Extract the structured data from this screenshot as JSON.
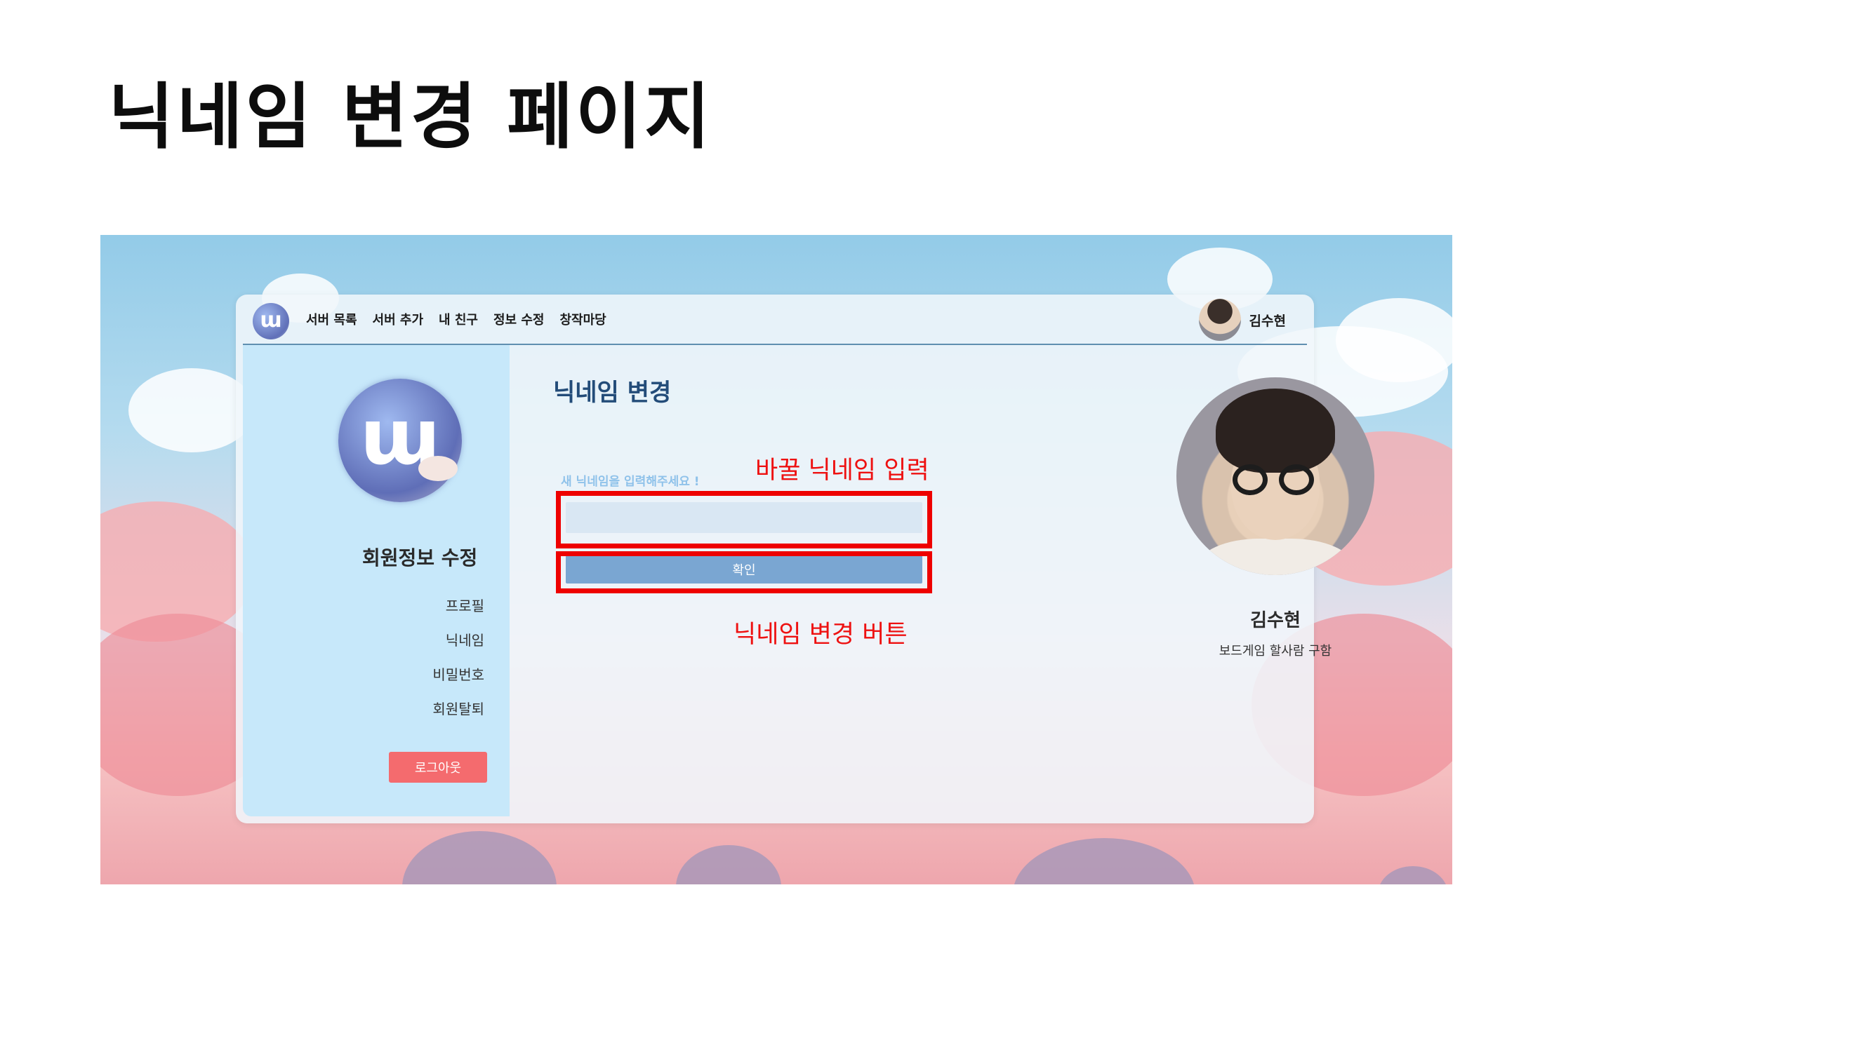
{
  "slide": {
    "title": "닉네임 변경 페이지"
  },
  "navbar": {
    "logo_text": "ɯ",
    "links": [
      {
        "label": "서버 목록"
      },
      {
        "label": "서버 추가"
      },
      {
        "label": "내 친구"
      },
      {
        "label": "정보 수정"
      },
      {
        "label": "창작마당"
      }
    ],
    "username": "김수현"
  },
  "sidebar": {
    "logo_text": "ɯ",
    "title": "회원정보 수정",
    "items": [
      {
        "label": "프로필"
      },
      {
        "label": "닉네임"
      },
      {
        "label": "비밀번호"
      },
      {
        "label": "회원탈퇴"
      }
    ],
    "logout_label": "로그아웃"
  },
  "main": {
    "heading": "닉네임 변경",
    "input_label": "새 닉네임을 입력해주세요 !",
    "input_value": "",
    "input_placeholder": "",
    "confirm_label": "확인"
  },
  "annotations": {
    "input_note": "바꿀 닉네임 입력",
    "button_note": "닉네임 변경 버튼",
    "highlight_color": "#ee0000"
  },
  "profile": {
    "name": "김수현",
    "status": "보드게임 할사람 구함"
  },
  "colors": {
    "sidebar_bg": "#c7e8fa",
    "heading": "#234c79",
    "confirm_button": "#7aa6d2",
    "logout_button": "#f46b6e"
  }
}
